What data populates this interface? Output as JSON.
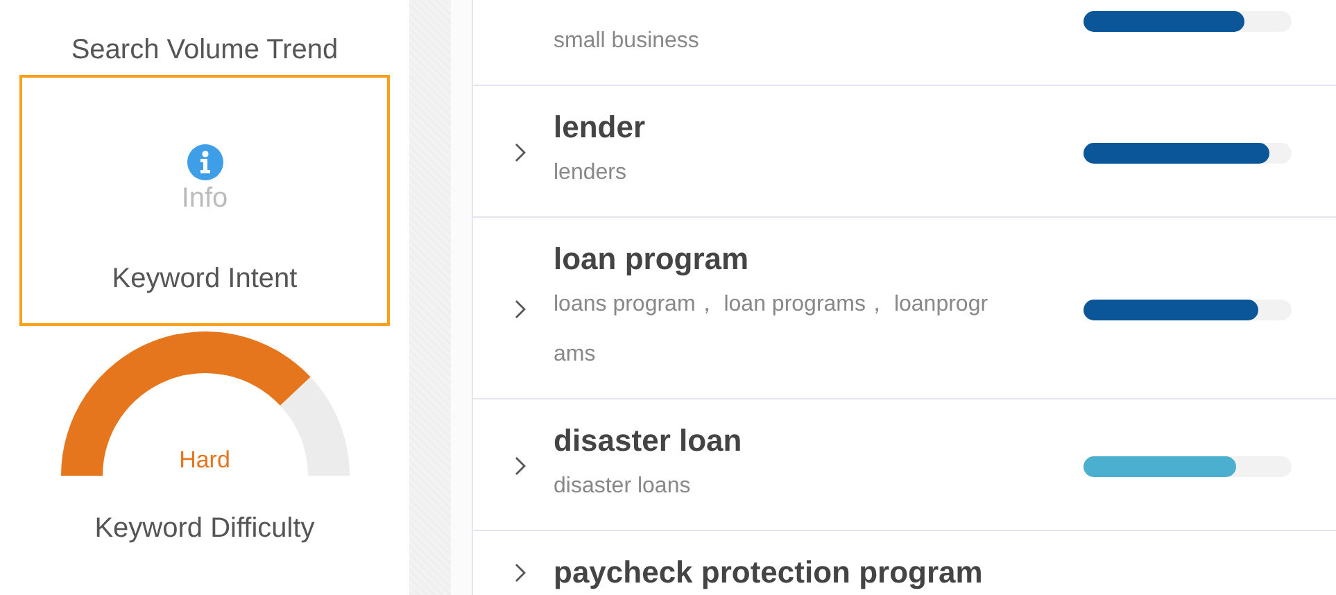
{
  "side_panel": {
    "trend": {
      "label": "Search Volume Trend"
    },
    "intent": {
      "value": "Info",
      "label": "Keyword Intent",
      "selected": true
    },
    "difficulty": {
      "value": "Hard",
      "label": "Keyword Difficulty"
    }
  },
  "keywords": [
    {
      "variants": "small business",
      "level": 0.77,
      "color": "#0a5699"
    },
    {
      "title": "lender",
      "variants": "lenders",
      "level": 0.89,
      "color": "#0a5699"
    },
    {
      "title": "loan program",
      "variants": "loans program， loan programs， loanprograms",
      "level": 0.84,
      "color": "#0a5699"
    },
    {
      "title": "disaster loan",
      "variants": "disaster loans",
      "level": 0.73,
      "color": "#4bafd0"
    },
    {
      "title": "paycheck protection program"
    }
  ]
}
